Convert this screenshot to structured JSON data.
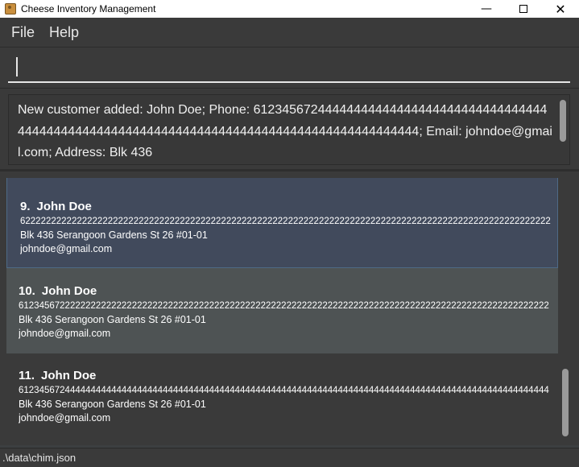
{
  "window": {
    "title": "Cheese Inventory Management",
    "controls": {
      "minimize": "—",
      "close": "✕"
    }
  },
  "menu": {
    "file": "File",
    "help": "Help"
  },
  "command": {
    "value": "",
    "placeholder": ""
  },
  "result": {
    "text": "New customer added: John Doe; Phone: 6123456724444444444444444444444444444444444444444444444444444444444444444444444444444444444444444; Email: johndoe@gmail.com; Address: Blk 436"
  },
  "customers": [
    {
      "index": "9.",
      "name": "John Doe",
      "phone": "6222222222222222222222222222222222222222222222222222222222222222222222222222222222222222222222222222222",
      "address": "Blk 436 Serangoon Gardens St 26 #01-01",
      "email": "johndoe@gmail.com"
    },
    {
      "index": "10.",
      "name": "John Doe",
      "phone": "6123456722222222222222222222222222222222222222222222222222222222222222222222222222222222222222222222222",
      "address": "Blk 436 Serangoon Gardens St 26 #01-01",
      "email": "johndoe@gmail.com"
    },
    {
      "index": "11.",
      "name": "John Doe",
      "phone": "6123456724444444444444444444444444444444444444444444444444444444444444444444444444444444444444444444444",
      "address": "Blk 436 Serangoon Gardens St 26 #01-01",
      "email": "johndoe@gmail.com"
    }
  ],
  "status": {
    "path": ".\\data\\chim.json"
  },
  "colors": {
    "background": "#3a3a3a",
    "selected_card": "#414a5c",
    "alt_card": "#4e5354",
    "text": "#ffffff"
  }
}
